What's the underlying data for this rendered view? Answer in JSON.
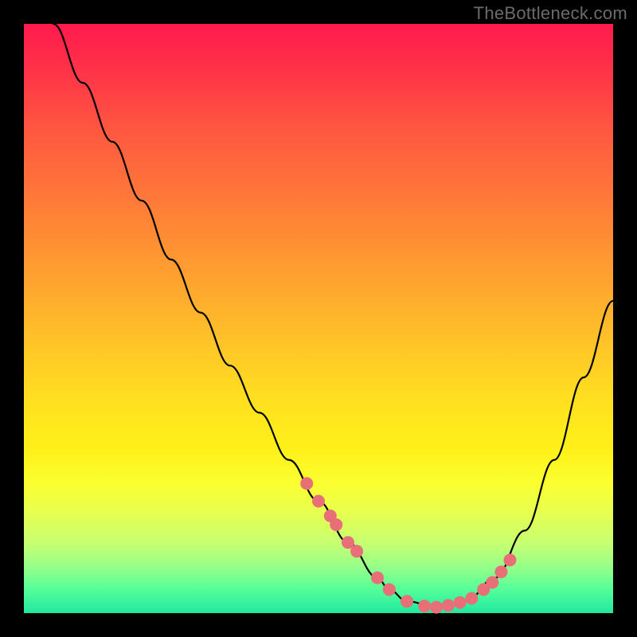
{
  "watermark": "TheBottleneck.com",
  "chart_data": {
    "type": "line",
    "title": "",
    "xlabel": "",
    "ylabel": "",
    "xlim": [
      0,
      100
    ],
    "ylim": [
      0,
      100
    ],
    "series": [
      {
        "name": "bottleneck-curve",
        "x": [
          5,
          10,
          15,
          20,
          25,
          30,
          35,
          40,
          45,
          50,
          55,
          60,
          62,
          65,
          70,
          75,
          80,
          85,
          90,
          95,
          100
        ],
        "values": [
          100,
          90,
          80,
          70,
          60,
          51,
          42,
          34,
          26,
          19,
          12,
          6,
          4,
          2,
          1,
          2,
          6,
          14,
          26,
          40,
          53
        ]
      }
    ],
    "markers": {
      "name": "highlight-dots",
      "color": "#e86f78",
      "x": [
        48,
        50,
        52,
        53,
        55,
        56.5,
        60,
        62,
        65,
        68,
        70,
        72,
        74,
        76,
        78,
        79.5,
        81,
        82.5
      ],
      "values": [
        22,
        19,
        16.5,
        15,
        12,
        10.5,
        6,
        4,
        2,
        1.2,
        1,
        1.3,
        1.8,
        2.5,
        4,
        5.2,
        7,
        9
      ]
    }
  }
}
